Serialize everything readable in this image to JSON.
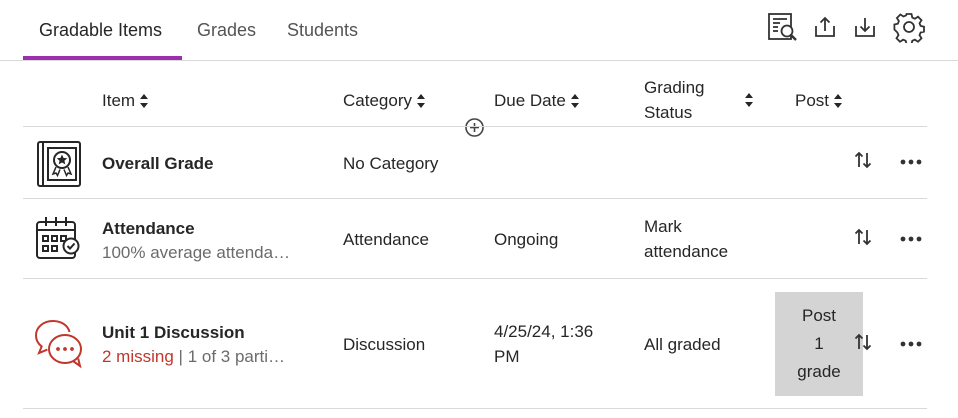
{
  "tabs": [
    {
      "label": "Gradable Items",
      "active": true
    },
    {
      "label": "Grades",
      "active": false
    },
    {
      "label": "Students",
      "active": false
    }
  ],
  "toolbar": {
    "icons": [
      "search-grades-icon",
      "upload-icon",
      "download-icon",
      "settings-gear-icon"
    ]
  },
  "columns": {
    "item": "Item",
    "category": "Category",
    "due_date": "Due Date",
    "grading_status_line1": "Grading",
    "grading_status_line2": "Status",
    "post": "Post"
  },
  "rows": [
    {
      "title": "Overall Grade",
      "category": "No Category",
      "icon": "gradebook-book-icon"
    },
    {
      "title": "Attendance",
      "subtitle": "100% average attenda…",
      "category": "Attendance",
      "due_date": "Ongoing",
      "status_line1": "Mark",
      "status_line2": "attendance",
      "icon": "attendance-calendar-icon"
    },
    {
      "title": "Unit 1 Discussion",
      "missing": "2 missing",
      "separator": " | ",
      "participation": "1 of 3 parti…",
      "category": "Discussion",
      "due_line1": "4/25/24, 1:36",
      "due_line2": "PM",
      "status": "All graded",
      "post_button": "Post\n1\ngrade",
      "icon": "discussion-bubbles-icon"
    }
  ],
  "colors": {
    "accent": "#9b2fae",
    "missing": "#c0372b",
    "discussion_icon": "#c0372b"
  }
}
